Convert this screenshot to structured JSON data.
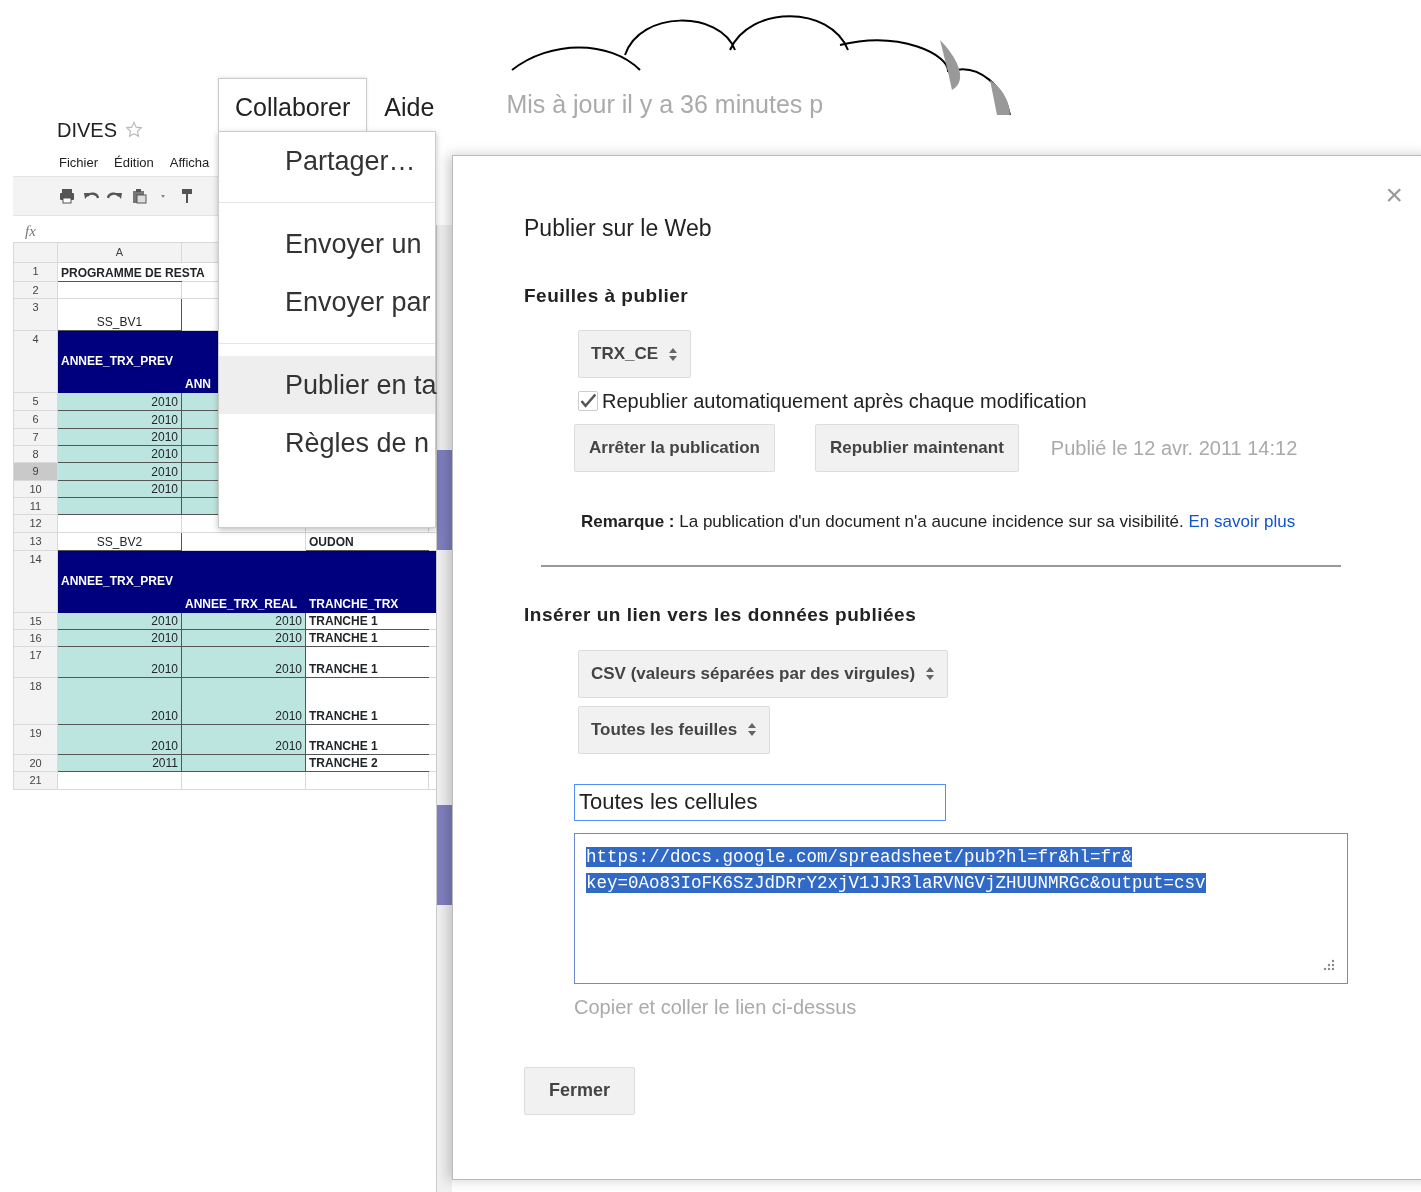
{
  "sheet": {
    "title": "DIVES",
    "starred": false,
    "menu": [
      "Fichier",
      "Édition",
      "Afficha"
    ],
    "formula_label": "fx",
    "column_headers": [
      "A"
    ],
    "rows": [
      {
        "number": "1",
        "selected": false,
        "cells": [
          {
            "kind": "bold",
            "text": "PROGRAMME DE RESTA"
          },
          {
            "kind": "plain"
          }
        ]
      },
      {
        "number": "2",
        "selected": false,
        "cells": [
          {
            "kind": "plain"
          },
          {
            "kind": "plain"
          }
        ]
      },
      {
        "number": "3",
        "selected": false,
        "cells": [
          {
            "kind": "center",
            "text": "SS_BV1"
          },
          {
            "kind": "plain"
          }
        ]
      },
      {
        "number": "4",
        "selected": false,
        "cells": [
          {
            "kind": "head",
            "text": "ANNEE_TRX_PREV"
          },
          {
            "kind": "head-low",
            "text": "ANN"
          }
        ]
      },
      {
        "number": "5",
        "selected": false,
        "cells": [
          {
            "kind": "num",
            "text": "2010"
          },
          {
            "kind": "num"
          }
        ]
      },
      {
        "number": "6",
        "selected": false,
        "cells": [
          {
            "kind": "num",
            "text": "2010"
          },
          {
            "kind": "num"
          }
        ]
      },
      {
        "number": "7",
        "selected": false,
        "cells": [
          {
            "kind": "num",
            "text": "2010"
          },
          {
            "kind": "num"
          }
        ]
      },
      {
        "number": "8",
        "selected": false,
        "cells": [
          {
            "kind": "num",
            "text": "2010"
          },
          {
            "kind": "num"
          }
        ]
      },
      {
        "number": "9",
        "selected": true,
        "cells": [
          {
            "kind": "num",
            "text": "2010"
          },
          {
            "kind": "num"
          }
        ]
      },
      {
        "number": "10",
        "selected": false,
        "cells": [
          {
            "kind": "num",
            "text": "2010"
          },
          {
            "kind": "num"
          }
        ]
      },
      {
        "number": "11",
        "selected": false,
        "cells": [
          {
            "kind": "num"
          },
          {
            "kind": "num"
          }
        ]
      },
      {
        "number": "12",
        "selected": false,
        "cells": [
          {
            "kind": "plain"
          },
          {
            "kind": "plain"
          }
        ]
      },
      {
        "number": "13",
        "selected": false,
        "cells": [
          {
            "kind": "center",
            "text": "SS_BV2"
          },
          {
            "kind": "plain"
          },
          {
            "kind": "bold",
            "text": "OUDON"
          },
          {
            "kind": "plain"
          }
        ]
      },
      {
        "number": "14",
        "selected": false,
        "cells": [
          {
            "kind": "head",
            "text": "ANNEE_TRX_PREV"
          },
          {
            "kind": "head-low",
            "text": "ANNEE_TRX_REAL"
          },
          {
            "kind": "head-low",
            "text": "TRANCHE_TRX"
          },
          {
            "kind": "head"
          }
        ]
      },
      {
        "number": "15",
        "selected": false,
        "cells": [
          {
            "kind": "num",
            "text": "2010"
          },
          {
            "kind": "num",
            "text": "2010"
          },
          {
            "kind": "bold",
            "text": "TRANCHE 1"
          },
          {
            "kind": "plain"
          }
        ]
      },
      {
        "number": "16",
        "selected": false,
        "cells": [
          {
            "kind": "num",
            "text": "2010"
          },
          {
            "kind": "num",
            "text": "2010"
          },
          {
            "kind": "bold",
            "text": "TRANCHE 1"
          },
          {
            "kind": "plain"
          }
        ]
      },
      {
        "number": "17",
        "selected": false,
        "cells": [
          {
            "kind": "num",
            "text": "2010"
          },
          {
            "kind": "num",
            "text": "2010"
          },
          {
            "kind": "bold",
            "text": "TRANCHE 1"
          },
          {
            "kind": "plain"
          }
        ]
      },
      {
        "number": "18",
        "selected": false,
        "cells": [
          {
            "kind": "num",
            "text": "2010"
          },
          {
            "kind": "num",
            "text": "2010"
          },
          {
            "kind": "bold",
            "text": "TRANCHE 1"
          },
          {
            "kind": "plain"
          }
        ]
      },
      {
        "number": "19",
        "selected": false,
        "cells": [
          {
            "kind": "num",
            "text": "2010"
          },
          {
            "kind": "num",
            "text": "2010"
          },
          {
            "kind": "bold",
            "text": "TRANCHE 1"
          },
          {
            "kind": "plain"
          }
        ]
      },
      {
        "number": "20",
        "selected": false,
        "cells": [
          {
            "kind": "num",
            "text": "2011"
          },
          {
            "kind": "num"
          },
          {
            "kind": "bold",
            "text": "TRANCHE 2"
          },
          {
            "kind": "plain"
          }
        ]
      },
      {
        "number": "21",
        "selected": false,
        "cells": [
          {
            "kind": "plain"
          },
          {
            "kind": "plain"
          },
          {
            "kind": "plain"
          },
          {
            "kind": "plain"
          }
        ]
      }
    ]
  },
  "menubar": {
    "items": [
      {
        "label": "Collaborer",
        "selected": true
      },
      {
        "label": "Aide",
        "selected": false
      }
    ],
    "status": "Mis à jour il y a 36 minutes p"
  },
  "dropdown": {
    "items": [
      {
        "label": "Partager…",
        "highlighted": false,
        "separator_after": true
      },
      {
        "label": "Envoyer un",
        "highlighted": false,
        "separator_after": false
      },
      {
        "label": "Envoyer par",
        "highlighted": false,
        "separator_after": true
      },
      {
        "label": "Publier en ta",
        "highlighted": true,
        "separator_after": false
      },
      {
        "label": "Règles de n",
        "highlighted": false,
        "separator_after": false
      }
    ]
  },
  "dialog": {
    "close_glyph": "×",
    "title": "Publier sur le Web",
    "sheets_heading": "Feuilles à publier",
    "sheet_select": "TRX_CE",
    "auto_republish": {
      "label": "Republier automatiquement après chaque modification",
      "checked": true
    },
    "buttons": [
      "Arrêter la publication",
      "Republier maintenant"
    ],
    "published": "Publié le 12 avr. 2011 14:12",
    "note": "**Remarque :** La publication d'un document n'a aucune incidence sur sa visibilité.",
    "note_link": "En savoir plus",
    "link_heading": "Insérer un lien vers les données publiées",
    "format_select": "CSV (valeurs séparées par des virgules)",
    "scope_select": "Toutes les feuilles",
    "range_field": "Toutes les cellules",
    "url": {
      "lines": [
        "https://docs.google.com/spreadsheet/pub?hl=fr&hl=fr&",
        "key=0Ao83IoFK6SzJdDRrY2xjV1JJR3laRVNGVjZHUUNMRGc&output=csv"
      ],
      "selected": true
    },
    "hint": "Copier et coller le lien ci-dessus",
    "close_button": "Fermer"
  }
}
